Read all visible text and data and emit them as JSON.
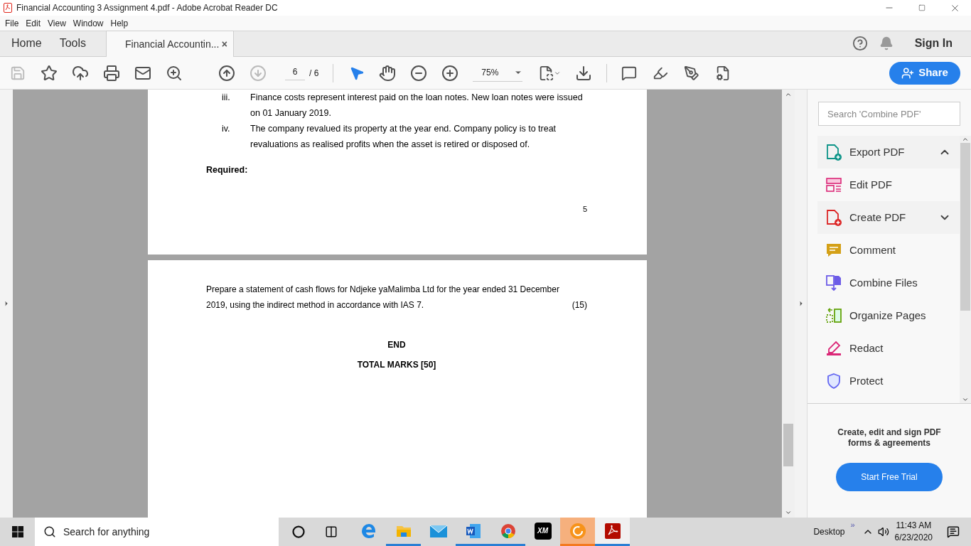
{
  "window": {
    "title": "Financial Accounting 3 Assignment 4.pdf - Adobe Acrobat Reader DC"
  },
  "menu": [
    "File",
    "Edit",
    "View",
    "Window",
    "Help"
  ],
  "tabs": [
    {
      "label": "Home",
      "selected": false,
      "kind": "nav"
    },
    {
      "label": "Tools",
      "selected": false,
      "kind": "nav"
    },
    {
      "label": "Financial Accountin...",
      "selected": true,
      "kind": "doc",
      "close": "×"
    }
  ],
  "account": {
    "sign_in": "Sign In"
  },
  "toolbar": {
    "page": "6",
    "page_total": "/ 6",
    "zoom": "75%",
    "share": "Share"
  },
  "document": {
    "pages": [
      {
        "items": [
          {
            "marker": "iii.",
            "text": "Finance costs represent interest paid on the loan notes. New loan notes were issued on 01 January 2019."
          },
          {
            "marker": "iv.",
            "text": "The company revalued its property at the year end. Company policy is to treat revaluations as realised profits when the asset is retired or disposed of."
          }
        ],
        "heading": "Required:",
        "page_number": "5"
      },
      {
        "paragraph": "Prepare a statement of cash flows for Ndjeke yaMalimba Ltd for the year ended 31 December 2019, using the indirect method in accordance with IAS 7.",
        "marks": "(15)",
        "end": "END",
        "total": "TOTAL MARKS [50]"
      }
    ]
  },
  "tools_panel": {
    "search_placeholder": "Search 'Combine PDF'",
    "tools": [
      {
        "label": "Export PDF",
        "kind": "export",
        "expanded": true
      },
      {
        "label": "Edit PDF",
        "kind": "edit"
      },
      {
        "label": "Create PDF",
        "kind": "create",
        "expanded": false
      },
      {
        "label": "Comment",
        "kind": "comment"
      },
      {
        "label": "Combine Files",
        "kind": "combine"
      },
      {
        "label": "Organize Pages",
        "kind": "organize"
      },
      {
        "label": "Redact",
        "kind": "redact"
      },
      {
        "label": "Protect",
        "kind": "protect"
      }
    ],
    "promo": "Create, edit and sign PDF forms & agreements",
    "trial": "Start Free Trial"
  },
  "taskbar": {
    "search_placeholder": "Search for anything",
    "apps": [
      {
        "kind": "edge",
        "running": false,
        "highlighted": false,
        "active": false
      },
      {
        "kind": "explorer",
        "running": true,
        "highlighted": false,
        "active": false
      },
      {
        "kind": "mail",
        "running": false,
        "highlighted": false,
        "active": false
      },
      {
        "kind": "word",
        "running": true,
        "highlighted": false,
        "active": false
      },
      {
        "kind": "chrome",
        "running": true,
        "highlighted": false,
        "active": false
      },
      {
        "kind": "xm",
        "running": false,
        "highlighted": false,
        "active": false,
        "label": "XM"
      },
      {
        "kind": "coin",
        "running": true,
        "highlighted": true,
        "active": false
      },
      {
        "kind": "acrobat",
        "running": true,
        "highlighted": false,
        "active": true
      }
    ],
    "desktop": "Desktop",
    "chevron": "»",
    "time": "11:43 AM",
    "date": "6/23/2020"
  }
}
